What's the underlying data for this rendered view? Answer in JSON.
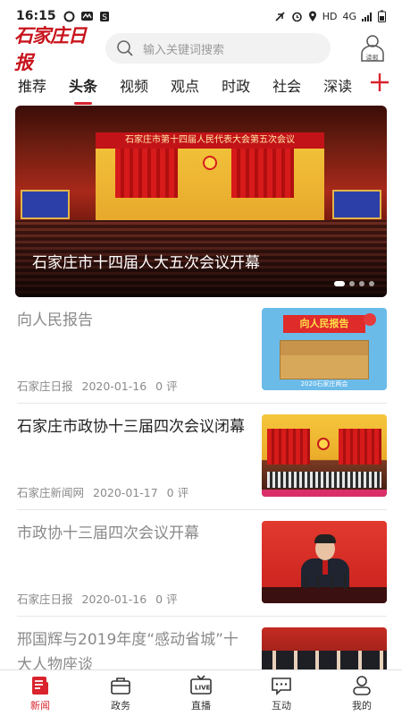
{
  "status_bar": {
    "time": "16:15",
    "network": "HD",
    "signal": "4G"
  },
  "header": {
    "logo": "石家庄日报",
    "search_placeholder": "输入关键词搜索",
    "read_label": "读报"
  },
  "tabs": [
    {
      "label": "推荐",
      "active": false
    },
    {
      "label": "头条",
      "active": true
    },
    {
      "label": "视频",
      "active": false
    },
    {
      "label": "观点",
      "active": false
    },
    {
      "label": "时政",
      "active": false
    },
    {
      "label": "社会",
      "active": false
    },
    {
      "label": "深读",
      "active": false
    }
  ],
  "banner": {
    "hall_title": "石家庄市第十四届人民代表大会第五次会议",
    "caption": "石家庄市十四届人大五次会议开幕",
    "slides": 4,
    "active_slide": 1
  },
  "news": [
    {
      "title": "向人民报告",
      "source": "石家庄日报",
      "date": "2020-01-16",
      "comments": "0 评",
      "read": true,
      "thumb_text": "向人民报告",
      "thumb_sub": "2020石家庄两会"
    },
    {
      "title": "石家庄市政协十三届四次会议闭幕",
      "source": "石家庄新闻网",
      "date": "2020-01-17",
      "comments": "0 评",
      "read": false
    },
    {
      "title": "市政协十三届四次会议开幕",
      "source": "石家庄日报",
      "date": "2020-01-16",
      "comments": "0 评",
      "read": true
    },
    {
      "title": "邢国辉与2019年度“感动省城”十大人物座谈",
      "read": true
    }
  ],
  "tabbar": [
    {
      "label": "新闻",
      "icon": "news-icon",
      "active": true
    },
    {
      "label": "政务",
      "icon": "briefcase-icon",
      "active": false
    },
    {
      "label": "直播",
      "icon": "live-tv-icon",
      "active": false
    },
    {
      "label": "互动",
      "icon": "chat-icon",
      "active": false
    },
    {
      "label": "我的",
      "icon": "user-icon",
      "active": false
    }
  ],
  "colors": {
    "accent": "#d9232d",
    "logo": "#c8141c"
  }
}
